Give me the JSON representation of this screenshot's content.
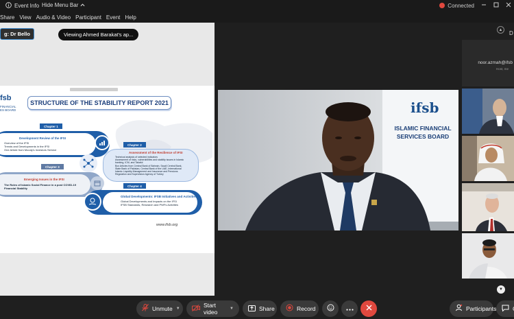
{
  "titlebar": {
    "event_info": "Event Info",
    "hide_menu": "Hide Menu Bar",
    "connected": "Connected"
  },
  "menu": [
    "Share",
    "View",
    "Audio & Video",
    "Participant",
    "Event",
    "Help"
  ],
  "share": {
    "speaking": "g: Dr Bello",
    "viewing": "Viewing Ahmed Barakat's ap..."
  },
  "slide": {
    "logo_frag": "fsb",
    "logo_sub_1": "FINANCIAL",
    "logo_sub_2": "ES BOARD",
    "title": "STRUCTURE OF THE STABILITY REPORT 2021",
    "chapters": [
      {
        "tag": "Chapter 1",
        "heading": "Development Review of the IFSI",
        "lines": [
          "Overview of the IFSI",
          "Trends and Developments in the IFSI",
          "One Article from Moody's Investors Service"
        ]
      },
      {
        "tag": "Chapter 2",
        "heading": "Assessment of the Resilience of IFSI",
        "lines": [
          "Technical analysis of selected indicators",
          "Assessment of risks, vulnerabilities and stability issues in Islamic",
          "banking, ICM, and Takaful",
          "Box Articles from Central Bank of Bahrain, Saudi Central Bank,",
          "State Bank of Pakistan, Central Bank of the UAE, International",
          "Islamic Liquidity Management and Insurance and Pensions",
          "Regulation and Supervision Agency of Turkey"
        ]
      },
      {
        "tag": "Chapter 3",
        "heading": "Emerging Issues in the IFSI",
        "lines": [
          "The Roles of Islamic Social Finance in a post COVID-19",
          "Financial Stability"
        ]
      },
      {
        "tag": "Chapter 4",
        "heading": "Global Developments: IFSB Initiatives and Activities",
        "lines": [
          "Global Developments and Impacts on the IFSI",
          "IFSB Standards, Research and PWFs Activities"
        ]
      }
    ],
    "url": "www.ifsb.org"
  },
  "speaker_video": {
    "logo": "ifsb",
    "line1": "ISLAMIC FINANCIAL",
    "line2": "SERVICES BOARD"
  },
  "gallery": {
    "d_label": "D",
    "tile1_name": "noor.azmah@ifsb",
    "tile1_sub": "Host, me"
  },
  "toolbar": {
    "unmute": "Unmute",
    "start_video": "Start video",
    "share": "Share",
    "record": "Record",
    "participants": "Participants",
    "chat": "Ch"
  },
  "colors": {
    "accent_blue": "#1f5ea8",
    "leave_red": "#e0483e",
    "toolbar_bg": "#3a3a3a"
  }
}
